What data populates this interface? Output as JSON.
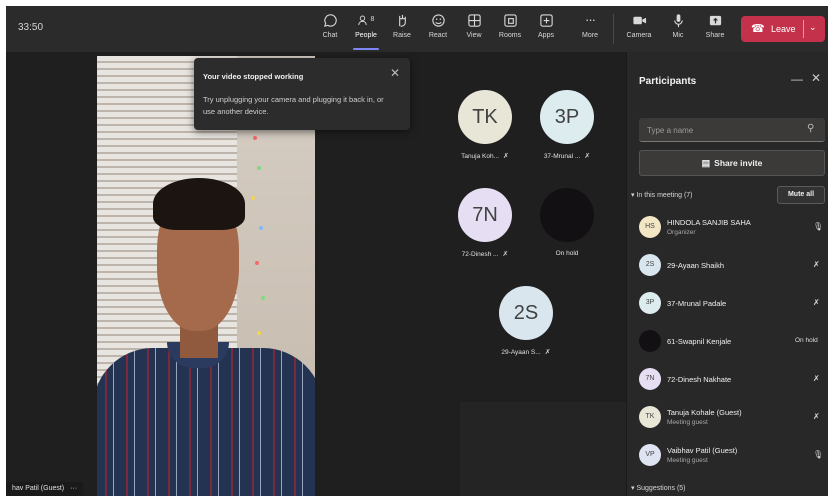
{
  "clock": "33:50",
  "toolbar": {
    "items": [
      {
        "label": "Chat",
        "icon": "chat-icon"
      },
      {
        "label": "People",
        "icon": "people-icon",
        "count": "8"
      },
      {
        "label": "Raise",
        "icon": "raise-hand-icon"
      },
      {
        "label": "React",
        "icon": "react-icon"
      },
      {
        "label": "View",
        "icon": "view-icon"
      },
      {
        "label": "Rooms",
        "icon": "rooms-icon"
      },
      {
        "label": "Apps",
        "icon": "apps-icon"
      },
      {
        "label": "More",
        "icon": "more-icon"
      }
    ],
    "devices": [
      {
        "label": "Camera",
        "icon": "camera-icon"
      },
      {
        "label": "Mic",
        "icon": "mic-icon"
      },
      {
        "label": "Share",
        "icon": "share-icon"
      }
    ],
    "leave_label": "Leave",
    "leave_color": "#c4314b",
    "active_accent": "#7f85f5"
  },
  "toast": {
    "title": "Your video stopped working",
    "body": "Try unplugging your camera and plugging it back in, or use another device."
  },
  "self_name": "hav Patil (Guest)",
  "self_more": "···",
  "tiles": [
    {
      "initials": "TK",
      "label": "Tanuja Koh...",
      "bg": "#e8e6d7"
    },
    {
      "initials": "3P",
      "label": "37-Mrunal ...",
      "bg": "#dcecef"
    },
    {
      "initials": "7N",
      "label": "72-Dinesh ...",
      "bg": "#e6def3"
    },
    {
      "initials": "",
      "label": "On hold",
      "bg": "#121012"
    },
    {
      "initials": "2S",
      "label": "29-Ayaan S...",
      "bg": "#d9e6ee"
    }
  ],
  "panel": {
    "title": "Participants",
    "search_placeholder": "Type a name",
    "share_invite": "Share invite",
    "in_meeting": "In this meeting (7)",
    "mute_all": "Mute all",
    "suggestions": "Suggestions (5)",
    "people": [
      {
        "initials": "HS",
        "name": "HINDOLA SANJIB SAHA",
        "role": "Organizer",
        "bg": "#f2e6c4",
        "status": "mic-on"
      },
      {
        "initials": "2S",
        "name": "29-Ayaan Shaikh",
        "role": "",
        "bg": "#d9e6ee",
        "status": "mic-off"
      },
      {
        "initials": "3P",
        "name": "37-Mrunal Padale",
        "role": "",
        "bg": "#dcecef",
        "status": "mic-off"
      },
      {
        "initials": "",
        "name": "61-Swapnil Kenjale",
        "role": "",
        "bg": "#121012",
        "status": "On hold"
      },
      {
        "initials": "7N",
        "name": "72-Dinesh Nakhate",
        "role": "",
        "bg": "#e6def3",
        "status": "mic-off"
      },
      {
        "initials": "TK",
        "name": "Tanuja Kohale (Guest)",
        "role": "Meeting guest",
        "bg": "#e8e6d7",
        "status": "mic-off"
      },
      {
        "initials": "VP",
        "name": "Vaibhav Patil (Guest)",
        "role": "Meeting guest",
        "bg": "#dfe4f3",
        "status": "mic-on"
      }
    ]
  }
}
